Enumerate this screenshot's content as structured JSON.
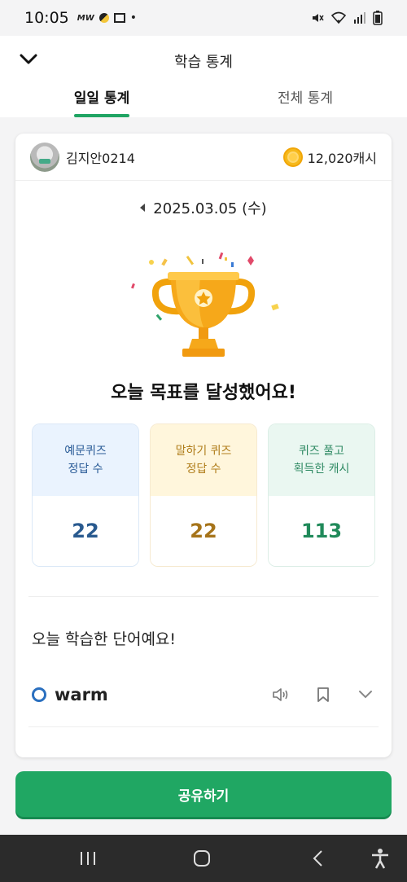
{
  "status": {
    "time": "10:05",
    "left_icons": [
      "carrier-icon",
      "pill-icon",
      "app-icon"
    ],
    "notification": "•"
  },
  "header": {
    "title": "학습 통계"
  },
  "tabs": [
    {
      "label": "일일 통계",
      "active": true
    },
    {
      "label": "전체 통계",
      "active": false
    }
  ],
  "profile": {
    "username": "김지안0214",
    "cash": "12,020캐시"
  },
  "date": "2025.03.05 (수)",
  "achievement": "오늘 목표를 달성했어요!",
  "stats": [
    {
      "line1": "예문퀴즈",
      "line2": "정답 수",
      "value": "22",
      "color": "#2a5b97"
    },
    {
      "line1": "말하기 퀴즈",
      "line2": "정답 수",
      "value": "22",
      "color": "#a6741a"
    },
    {
      "line1": "퀴즈 풀고",
      "line2": "획득한 캐시",
      "value": "113",
      "color": "#208a5a"
    }
  ],
  "words_title": "오늘 학습한 단어예요!",
  "words": [
    {
      "text": "warm"
    }
  ],
  "share_button": "공유하기",
  "colors": {
    "accent": "#20a763",
    "word_circle": "#2a6fbf",
    "trophy": "#f5a623"
  }
}
